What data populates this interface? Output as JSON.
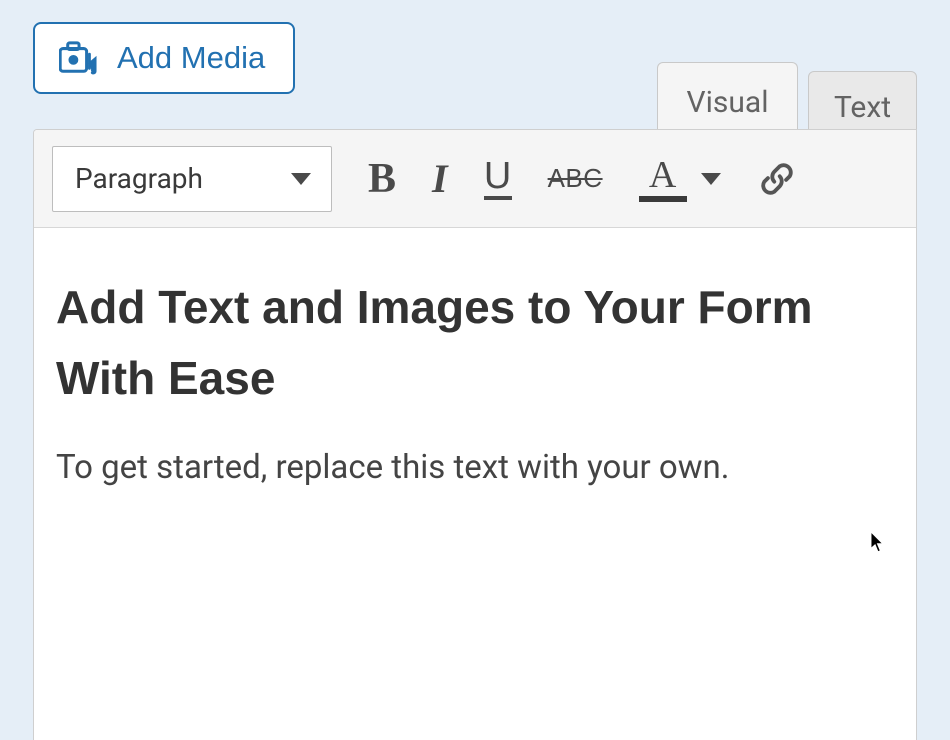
{
  "add_media": {
    "label": "Add Media"
  },
  "tabs": {
    "visual": "Visual",
    "text": "Text"
  },
  "toolbar": {
    "format": "Paragraph",
    "bold": "B",
    "italic": "I",
    "underline": "U",
    "strike": "ABC",
    "textcolor": "A"
  },
  "editor": {
    "heading": "Add Text and Images to Your Form With Ease",
    "body": "To get started, replace this text with your own."
  }
}
